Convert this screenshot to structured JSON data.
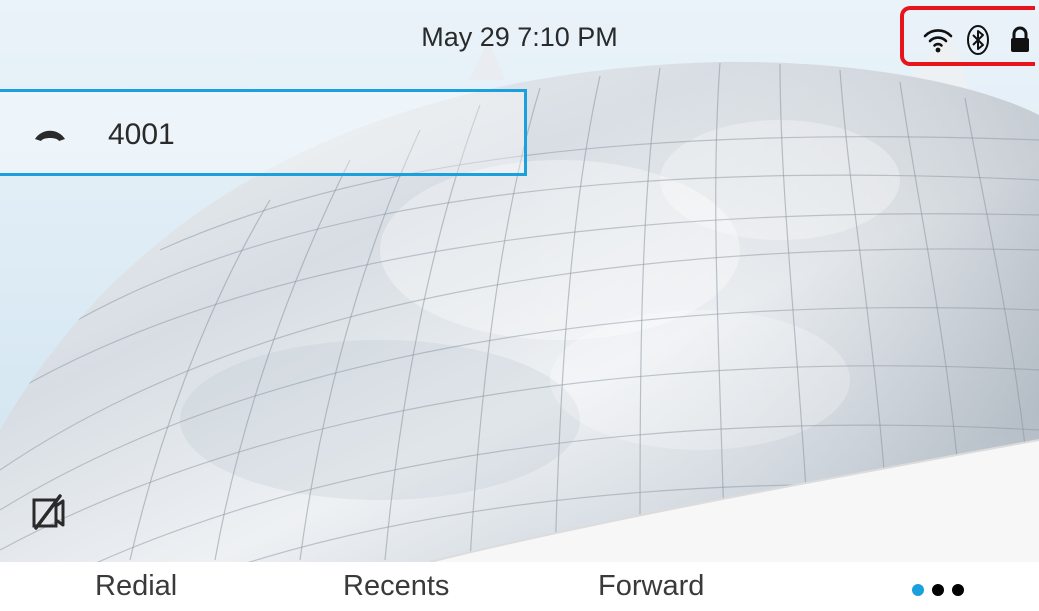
{
  "status_bar": {
    "datetime": "May 29 7:10 PM",
    "icons": [
      "wifi-icon",
      "bluetooth-icon",
      "lock-icon"
    ],
    "highlight_color": "#e8141c"
  },
  "line_key": {
    "label": "4001",
    "icon": "phone-icon",
    "border_color": "#1ba0de"
  },
  "video_status": {
    "icon": "video-mute-icon"
  },
  "softkeys": {
    "redial": "Redial",
    "recents": "Recents",
    "forward": "Forward",
    "more_icon": "more-dots-icon",
    "more_dot_colors": [
      "#1ba0de",
      "#000000",
      "#000000"
    ]
  }
}
